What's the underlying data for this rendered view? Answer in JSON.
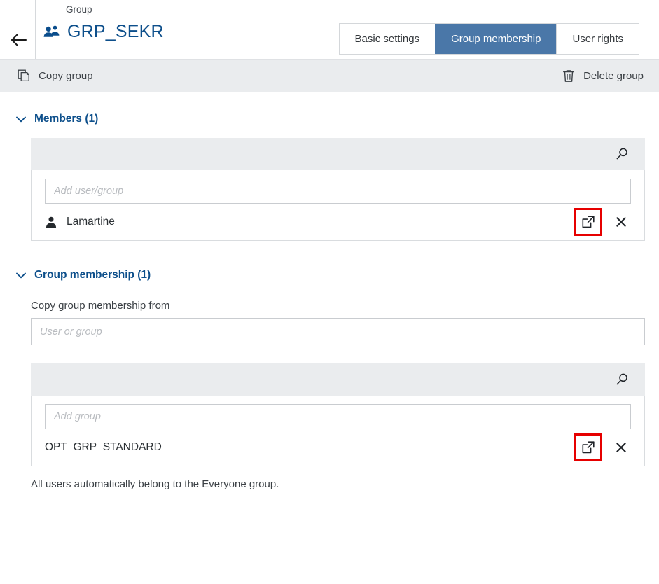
{
  "header": {
    "back_icon": "arrow-left-icon",
    "eyebrow": "Group",
    "group_icon": "group-people-icon",
    "title": "GRP_SEKR"
  },
  "tabs": [
    {
      "label": "Basic settings",
      "active": false
    },
    {
      "label": "Group membership",
      "active": true
    },
    {
      "label": "User rights",
      "active": false
    }
  ],
  "toolbar": {
    "copy_icon": "copy-icon",
    "copy_label": "Copy group",
    "delete_icon": "trash-icon",
    "delete_label": "Delete group"
  },
  "members_section": {
    "chevron_icon": "chevron-down-icon",
    "title": "Members (1)",
    "search_icon": "search-icon",
    "add_placeholder": "Add user/group",
    "rows": [
      {
        "icon": "person-icon",
        "label": "Lamartine",
        "open_icon": "external-link-icon",
        "remove_icon": "close-icon",
        "highlighted": true
      }
    ]
  },
  "group_membership_section": {
    "chevron_icon": "chevron-down-icon",
    "title": "Group membership (1)",
    "copy_from_label": "Copy group membership from",
    "copy_from_placeholder": "User or group",
    "search_icon": "search-icon",
    "add_placeholder": "Add group",
    "rows": [
      {
        "label": "OPT_GRP_STANDARD",
        "open_icon": "external-link-icon",
        "remove_icon": "close-icon",
        "highlighted": true
      }
    ],
    "note": "All users automatically belong to the Everyone group."
  },
  "colors": {
    "accent_blue": "#0d4f8b",
    "active_tab_bg": "#4a77a8",
    "toolbar_bg": "#eaecee",
    "highlight_red": "#e60000",
    "border_gray": "#d9dcdf"
  }
}
